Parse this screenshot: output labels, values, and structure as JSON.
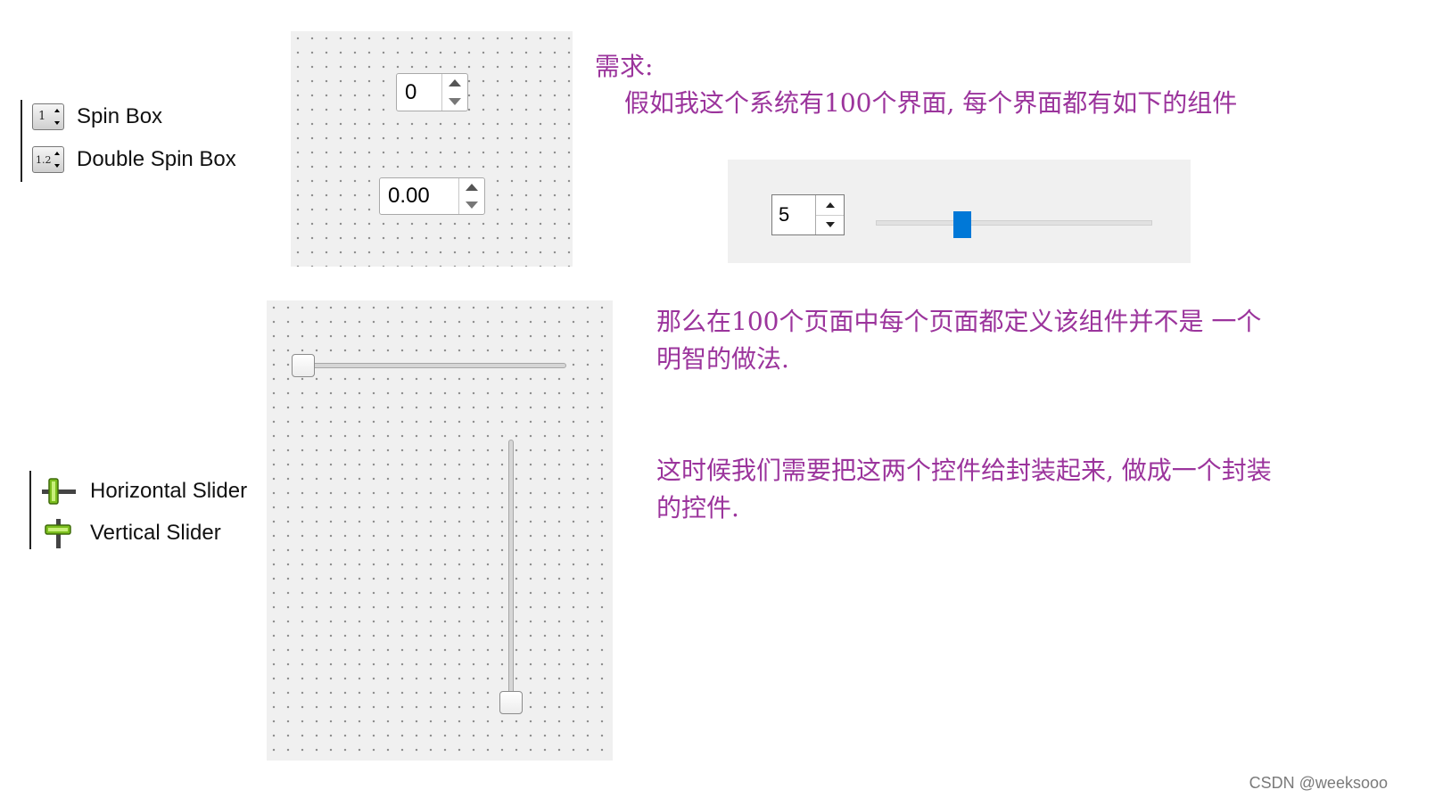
{
  "spin_palette": {
    "items": [
      {
        "icon": "spin-box-icon",
        "icon_text": "1",
        "label": "Spin Box"
      },
      {
        "icon": "double-spin-box-icon",
        "icon_text": "1.2",
        "label": "Double Spin Box"
      }
    ]
  },
  "slider_palette": {
    "items": [
      {
        "icon": "horizontal-slider-icon",
        "label": "Horizontal Slider"
      },
      {
        "icon": "vertical-slider-icon",
        "label": "Vertical Slider"
      }
    ]
  },
  "spin_canvas": {
    "spin_box_value": "0",
    "double_spin_box_value": "0.00"
  },
  "slider_canvas": {
    "horizontal_slider_value_fraction": 0.0,
    "vertical_slider_value_fraction": 0.0
  },
  "composite_widget": {
    "spin_value": "5",
    "slider_value_fraction": 0.3,
    "accent_color": "#0078d7"
  },
  "notes": {
    "requirement_title": "需求:",
    "requirement_body": "假如我这个系统有100个界面, 每个界面都有如下的组件",
    "para2_line1": "那么在100个页面中每个页面都定义该组件并不是  一个",
    "para2_line2": "明智的做法.",
    "para3_line1": "这时候我们需要把这两个控件给封装起来, 做成一个封装",
    "para3_line2": "的控件."
  },
  "watermark": "CSDN @weeksooo",
  "colors": {
    "note_text": "#9b349c",
    "canvas_bg": "#f0f0f0"
  }
}
